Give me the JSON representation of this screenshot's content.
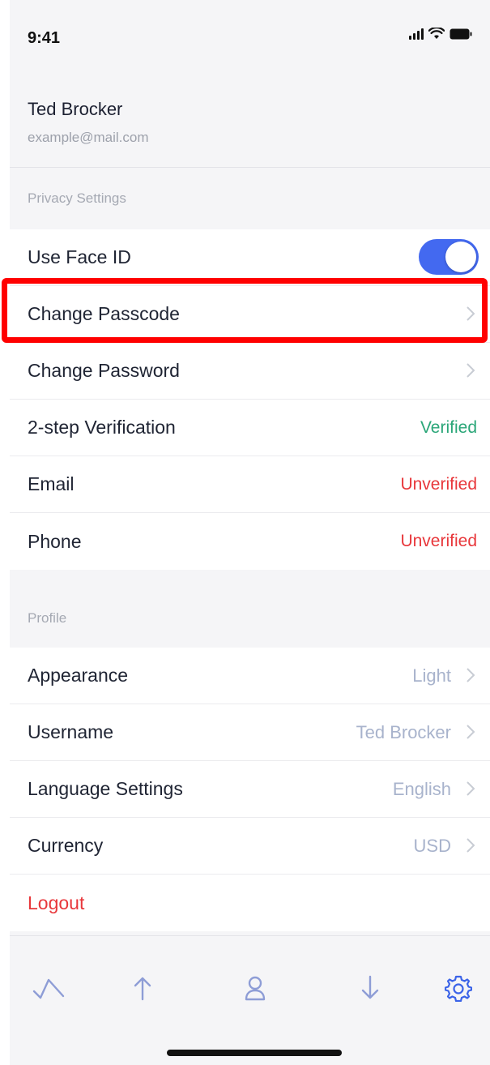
{
  "status_bar": {
    "time": "9:41"
  },
  "profile": {
    "name": "Ted Brocker",
    "email": "example@mail.com"
  },
  "privacy": {
    "header": "Privacy Settings",
    "face_id": {
      "label": "Use Face ID",
      "enabled": true
    },
    "change_passcode": {
      "label": "Change Passcode"
    },
    "change_password": {
      "label": "Change Password"
    },
    "two_step": {
      "label": "2-step Verification",
      "status": "Verified"
    },
    "email": {
      "label": "Email",
      "status": "Unverified"
    },
    "phone": {
      "label": "Phone",
      "status": "Unverified"
    }
  },
  "profile_section": {
    "header": "Profile",
    "appearance": {
      "label": "Appearance",
      "value": "Light"
    },
    "username": {
      "label": "Username",
      "value": "Ted Brocker"
    },
    "language": {
      "label": "Language Settings",
      "value": "English"
    },
    "currency": {
      "label": "Currency",
      "value": "USD"
    },
    "logout": {
      "label": "Logout"
    }
  },
  "tabbar": {
    "icons": [
      "chart-trend-icon",
      "arrow-up-icon",
      "person-icon",
      "arrow-down-icon",
      "gear-icon"
    ],
    "active": "gear-icon"
  },
  "colors": {
    "accent": "#4369f0",
    "verified": "#2aa678",
    "unverified": "#e8373b",
    "highlight": "#ff0000"
  }
}
